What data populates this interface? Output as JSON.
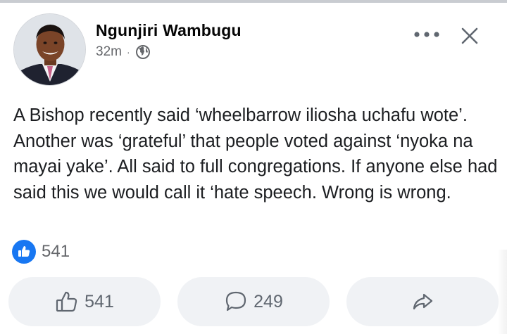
{
  "post": {
    "author": "Ngunjiri Wambugu",
    "time": "32m",
    "separator": "·",
    "privacy_icon": "globe-icon",
    "text": "A Bishop recently said ‘wheelbarrow iliosha uchafu wote’. Another was ‘grateful’ that people voted against ‘nyoka na mayai yake’. All said to full congregations. If anyone else had said this we would call it ‘hate speech. Wrong is wrong."
  },
  "header_actions": {
    "more_icon": "more-options-icon",
    "close_icon": "close-icon"
  },
  "reactions": {
    "icon": "like-reaction-icon",
    "count": "541"
  },
  "actions": {
    "like": {
      "icon": "thumbs-up-icon",
      "count": "541"
    },
    "comment": {
      "icon": "comment-icon",
      "count": "249"
    },
    "share": {
      "icon": "share-icon"
    }
  },
  "colors": {
    "accent": "#1877f2",
    "button_bg": "#f0f2f5",
    "secondary_text": "#65676b"
  }
}
